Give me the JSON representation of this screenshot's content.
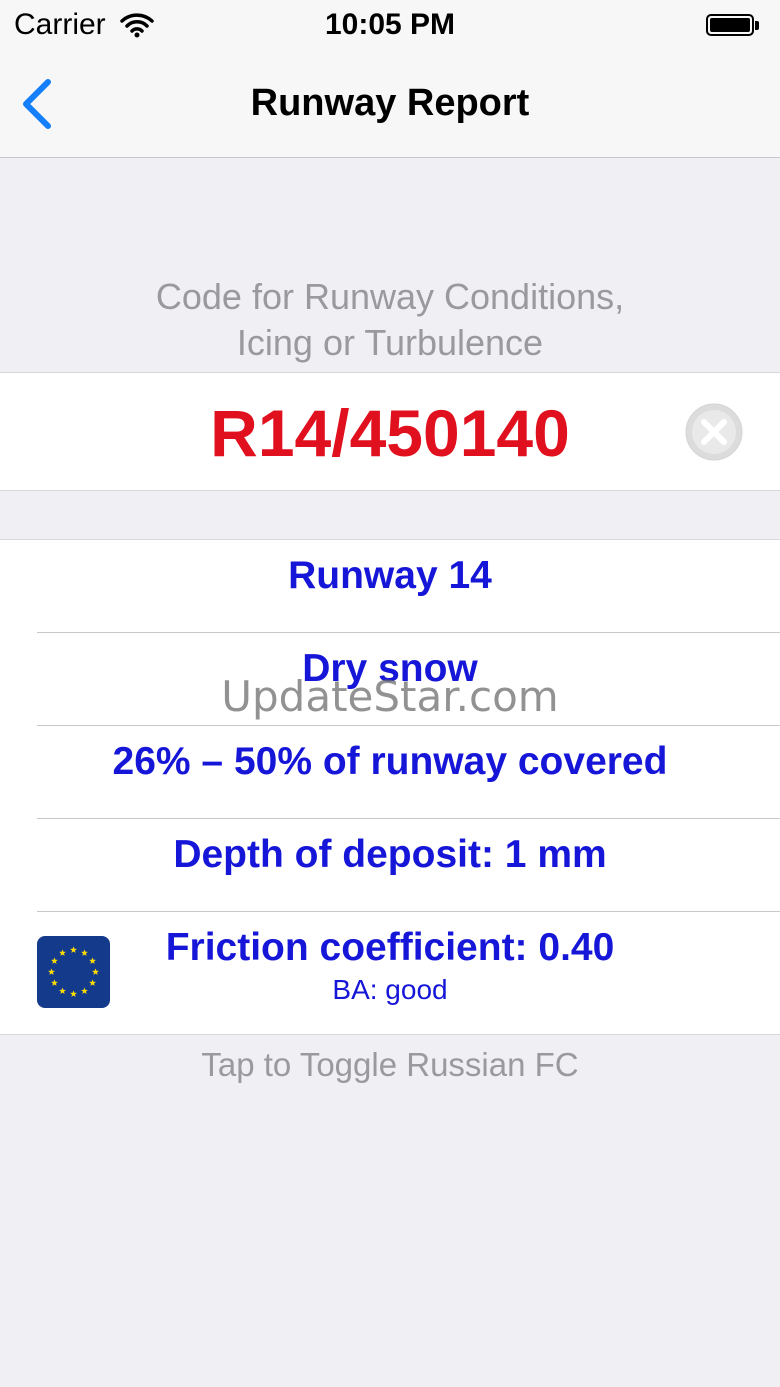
{
  "status_bar": {
    "carrier": "Carrier",
    "time": "10:05 PM",
    "wifi_icon": "wifi-icon",
    "battery_icon": "battery-icon"
  },
  "nav": {
    "title": "Runway Report",
    "back_icon": "chevron-left-icon",
    "tint": "#147efb"
  },
  "input": {
    "header_line1": "Code for Runway Conditions,",
    "header_line2": "Icing or Turbulence",
    "code": "R14/450140",
    "code_color": "#e0101e",
    "clear_icon": "clear-circle-icon"
  },
  "results": {
    "color": "#1616d8",
    "rows": [
      {
        "text": "Runway 14"
      },
      {
        "text": "Dry snow"
      },
      {
        "text": "26% – 50% of runway covered"
      },
      {
        "text": "Depth of deposit: 1 mm"
      },
      {
        "text": "Friction coefficient: 0.40",
        "subtext": "BA: good",
        "icon": "eu-flag-icon"
      }
    ]
  },
  "watermark": "UpdateStar.com",
  "footer": "Tap to Toggle Russian FC"
}
